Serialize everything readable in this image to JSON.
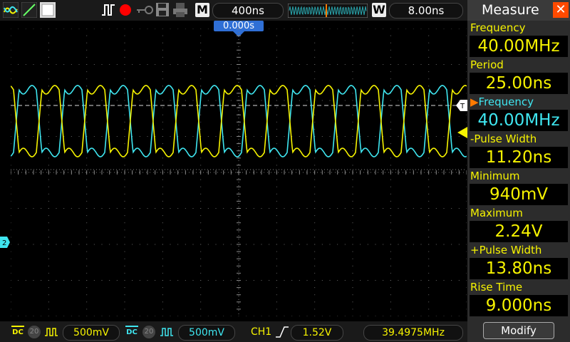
{
  "topbar": {
    "timebase": "400ns",
    "trigger_delay": "8.00ns",
    "mode_letter": "M",
    "w_letter": "W",
    "cursor_time": "0.000s"
  },
  "bottombar": {
    "ch1_coupling": "DC",
    "ch1_bw": "20",
    "ch1_scale": "500mV",
    "ch2_coupling": "DC",
    "ch2_bw": "20",
    "ch2_scale": "500mV",
    "trigger_source": "CH1",
    "trigger_level": "1.52V",
    "frequency_counter": "39.4975MHz"
  },
  "panel": {
    "title": "Measure",
    "measurements": [
      {
        "label": "Frequency",
        "value": "40.00MHz",
        "channel": "ch1"
      },
      {
        "label": "Period",
        "value": "25.00ns",
        "channel": "ch1"
      },
      {
        "label": "Frequency",
        "value": "40.00MHz",
        "channel": "ch2"
      },
      {
        "label": "-Pulse Width",
        "value": "11.20ns",
        "channel": "ch1"
      },
      {
        "label": "Minimum",
        "value": "940mV",
        "channel": "ch1"
      },
      {
        "label": "Maximum",
        "value": "2.24V",
        "channel": "ch1"
      },
      {
        "label": "+Pulse Width",
        "value": "13.80ns",
        "channel": "ch1"
      },
      {
        "label": "Rise Time",
        "value": "9.000ns",
        "channel": "ch1"
      }
    ],
    "modify_label": "Modify"
  },
  "colors": {
    "ch1": "#f6f300",
    "ch2": "#3fe6f0",
    "accent": "#ff7a00"
  }
}
